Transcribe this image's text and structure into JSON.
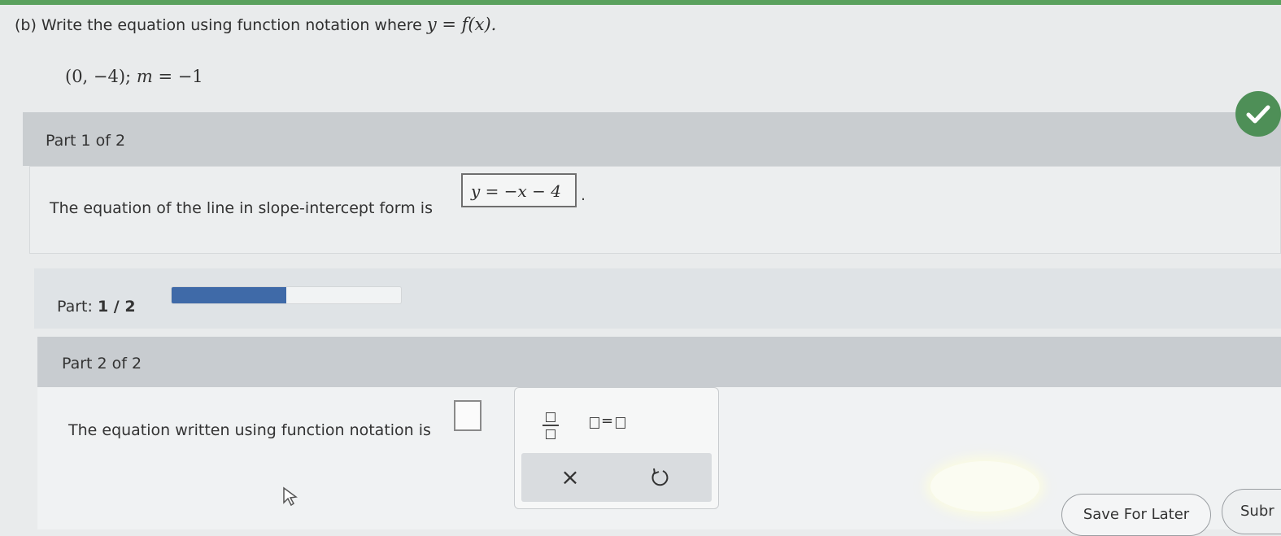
{
  "question": {
    "prefix": "(b) Write the equation using function notation where",
    "math": "y = f(x).",
    "given_point": "(0, −4);",
    "given_slope_var": "m",
    "given_slope_val": "= −1"
  },
  "part1": {
    "header": "Part 1 of 2",
    "statement": "The equation of the line in slope-intercept form is",
    "answer": "y = −x − 4",
    "period": ".",
    "status_icon": "check-icon"
  },
  "progress": {
    "label": "Part:",
    "value_text": "1 / 2",
    "fraction": 0.5,
    "fill_color": "#3f6aa8"
  },
  "part2": {
    "header": "Part 2 of 2",
    "statement": "The equation written using function notation is",
    "input_value": ""
  },
  "keypad": {
    "fraction_button_icon": "fraction-icon",
    "equals_button_icon": "box-equals-box-icon",
    "equals_symbol": "=",
    "clear_symbol": "×",
    "undo_icon": "undo-icon"
  },
  "footer": {
    "save_label": "Save For Later",
    "submit_label": "Subr"
  },
  "colors": {
    "accent_green": "#4e8f57",
    "top_strip": "#5aa15e"
  }
}
